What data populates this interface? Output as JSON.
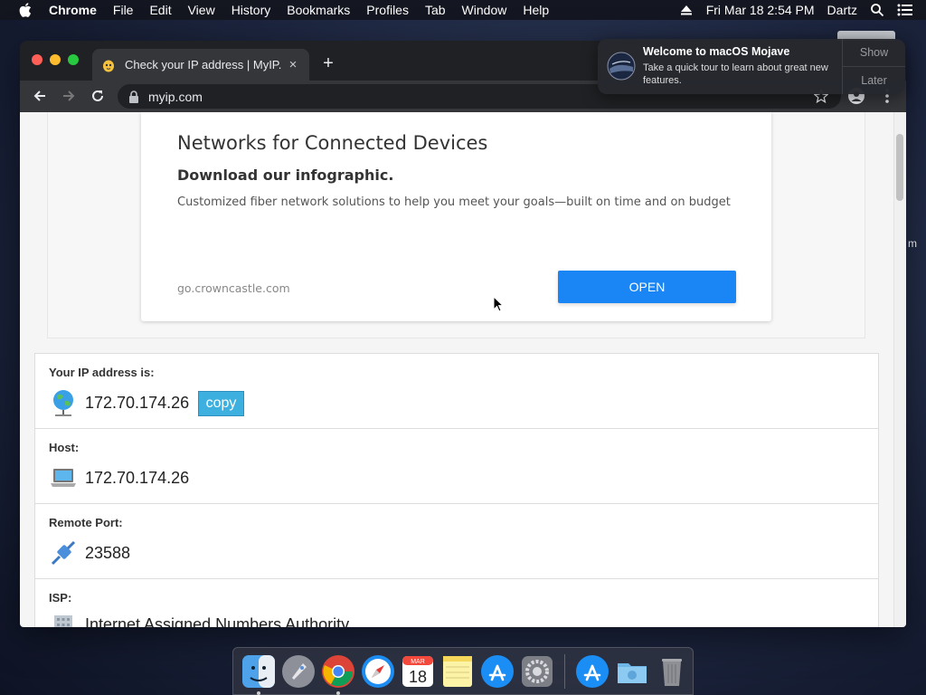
{
  "menubar": {
    "app_name": "Chrome",
    "items": [
      "File",
      "Edit",
      "View",
      "History",
      "Bookmarks",
      "Profiles",
      "Tab",
      "Window",
      "Help"
    ],
    "datetime": "Fri Mar 18  2:54 PM",
    "user": "Dartz"
  },
  "browser": {
    "tab_title": "Check your IP address | MyIP.",
    "new_tab_symbol": "+",
    "close_symbol": "×",
    "url": "myip.com"
  },
  "ad": {
    "title": "Networks for Connected Devices",
    "subtitle": "Download our infographic.",
    "description": "Customized fiber network solutions to help you meet your goals—built on time and on budget",
    "display_url": "go.crowncastle.com",
    "cta": "OPEN"
  },
  "ip_info": {
    "ip_label": "Your IP address is:",
    "ip_value": "172.70.174.26",
    "copy_label": "copy",
    "host_label": "Host:",
    "host_value": "172.70.174.26",
    "port_label": "Remote Port:",
    "port_value": "23588",
    "isp_label": "ISP:",
    "isp_value": "Internet Assigned Numbers Authority"
  },
  "notification": {
    "title": "Welcome to macOS Mojave",
    "body": "Take a quick tour to learn about great new features.",
    "action_primary": "Show",
    "action_secondary": "Later"
  },
  "dock": {
    "calendar_month": "MAR",
    "calendar_day": "18"
  },
  "desktop": {
    "partial_label": "m"
  },
  "colors": {
    "accent_blue": "#1a86f5",
    "copy_button": "#3db0e0"
  }
}
